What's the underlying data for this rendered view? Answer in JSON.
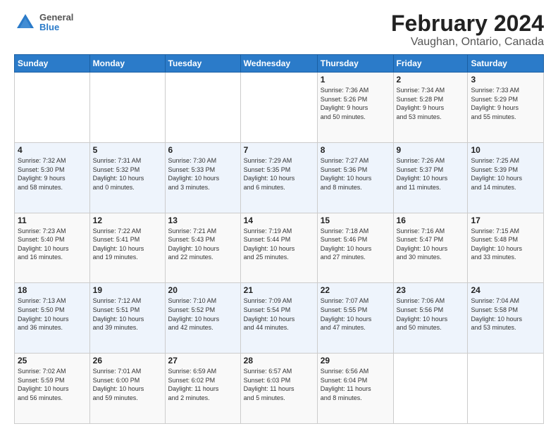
{
  "header": {
    "logo_line1": "General",
    "logo_line2": "Blue",
    "title": "February 2024",
    "subtitle": "Vaughan, Ontario, Canada"
  },
  "weekdays": [
    "Sunday",
    "Monday",
    "Tuesday",
    "Wednesday",
    "Thursday",
    "Friday",
    "Saturday"
  ],
  "weeks": [
    [
      {
        "day": "",
        "info": ""
      },
      {
        "day": "",
        "info": ""
      },
      {
        "day": "",
        "info": ""
      },
      {
        "day": "",
        "info": ""
      },
      {
        "day": "1",
        "info": "Sunrise: 7:36 AM\nSunset: 5:26 PM\nDaylight: 9 hours\nand 50 minutes."
      },
      {
        "day": "2",
        "info": "Sunrise: 7:34 AM\nSunset: 5:28 PM\nDaylight: 9 hours\nand 53 minutes."
      },
      {
        "day": "3",
        "info": "Sunrise: 7:33 AM\nSunset: 5:29 PM\nDaylight: 9 hours\nand 55 minutes."
      }
    ],
    [
      {
        "day": "4",
        "info": "Sunrise: 7:32 AM\nSunset: 5:30 PM\nDaylight: 9 hours\nand 58 minutes."
      },
      {
        "day": "5",
        "info": "Sunrise: 7:31 AM\nSunset: 5:32 PM\nDaylight: 10 hours\nand 0 minutes."
      },
      {
        "day": "6",
        "info": "Sunrise: 7:30 AM\nSunset: 5:33 PM\nDaylight: 10 hours\nand 3 minutes."
      },
      {
        "day": "7",
        "info": "Sunrise: 7:29 AM\nSunset: 5:35 PM\nDaylight: 10 hours\nand 6 minutes."
      },
      {
        "day": "8",
        "info": "Sunrise: 7:27 AM\nSunset: 5:36 PM\nDaylight: 10 hours\nand 8 minutes."
      },
      {
        "day": "9",
        "info": "Sunrise: 7:26 AM\nSunset: 5:37 PM\nDaylight: 10 hours\nand 11 minutes."
      },
      {
        "day": "10",
        "info": "Sunrise: 7:25 AM\nSunset: 5:39 PM\nDaylight: 10 hours\nand 14 minutes."
      }
    ],
    [
      {
        "day": "11",
        "info": "Sunrise: 7:23 AM\nSunset: 5:40 PM\nDaylight: 10 hours\nand 16 minutes."
      },
      {
        "day": "12",
        "info": "Sunrise: 7:22 AM\nSunset: 5:41 PM\nDaylight: 10 hours\nand 19 minutes."
      },
      {
        "day": "13",
        "info": "Sunrise: 7:21 AM\nSunset: 5:43 PM\nDaylight: 10 hours\nand 22 minutes."
      },
      {
        "day": "14",
        "info": "Sunrise: 7:19 AM\nSunset: 5:44 PM\nDaylight: 10 hours\nand 25 minutes."
      },
      {
        "day": "15",
        "info": "Sunrise: 7:18 AM\nSunset: 5:46 PM\nDaylight: 10 hours\nand 27 minutes."
      },
      {
        "day": "16",
        "info": "Sunrise: 7:16 AM\nSunset: 5:47 PM\nDaylight: 10 hours\nand 30 minutes."
      },
      {
        "day": "17",
        "info": "Sunrise: 7:15 AM\nSunset: 5:48 PM\nDaylight: 10 hours\nand 33 minutes."
      }
    ],
    [
      {
        "day": "18",
        "info": "Sunrise: 7:13 AM\nSunset: 5:50 PM\nDaylight: 10 hours\nand 36 minutes."
      },
      {
        "day": "19",
        "info": "Sunrise: 7:12 AM\nSunset: 5:51 PM\nDaylight: 10 hours\nand 39 minutes."
      },
      {
        "day": "20",
        "info": "Sunrise: 7:10 AM\nSunset: 5:52 PM\nDaylight: 10 hours\nand 42 minutes."
      },
      {
        "day": "21",
        "info": "Sunrise: 7:09 AM\nSunset: 5:54 PM\nDaylight: 10 hours\nand 44 minutes."
      },
      {
        "day": "22",
        "info": "Sunrise: 7:07 AM\nSunset: 5:55 PM\nDaylight: 10 hours\nand 47 minutes."
      },
      {
        "day": "23",
        "info": "Sunrise: 7:06 AM\nSunset: 5:56 PM\nDaylight: 10 hours\nand 50 minutes."
      },
      {
        "day": "24",
        "info": "Sunrise: 7:04 AM\nSunset: 5:58 PM\nDaylight: 10 hours\nand 53 minutes."
      }
    ],
    [
      {
        "day": "25",
        "info": "Sunrise: 7:02 AM\nSunset: 5:59 PM\nDaylight: 10 hours\nand 56 minutes."
      },
      {
        "day": "26",
        "info": "Sunrise: 7:01 AM\nSunset: 6:00 PM\nDaylight: 10 hours\nand 59 minutes."
      },
      {
        "day": "27",
        "info": "Sunrise: 6:59 AM\nSunset: 6:02 PM\nDaylight: 11 hours\nand 2 minutes."
      },
      {
        "day": "28",
        "info": "Sunrise: 6:57 AM\nSunset: 6:03 PM\nDaylight: 11 hours\nand 5 minutes."
      },
      {
        "day": "29",
        "info": "Sunrise: 6:56 AM\nSunset: 6:04 PM\nDaylight: 11 hours\nand 8 minutes."
      },
      {
        "day": "",
        "info": ""
      },
      {
        "day": "",
        "info": ""
      }
    ]
  ]
}
